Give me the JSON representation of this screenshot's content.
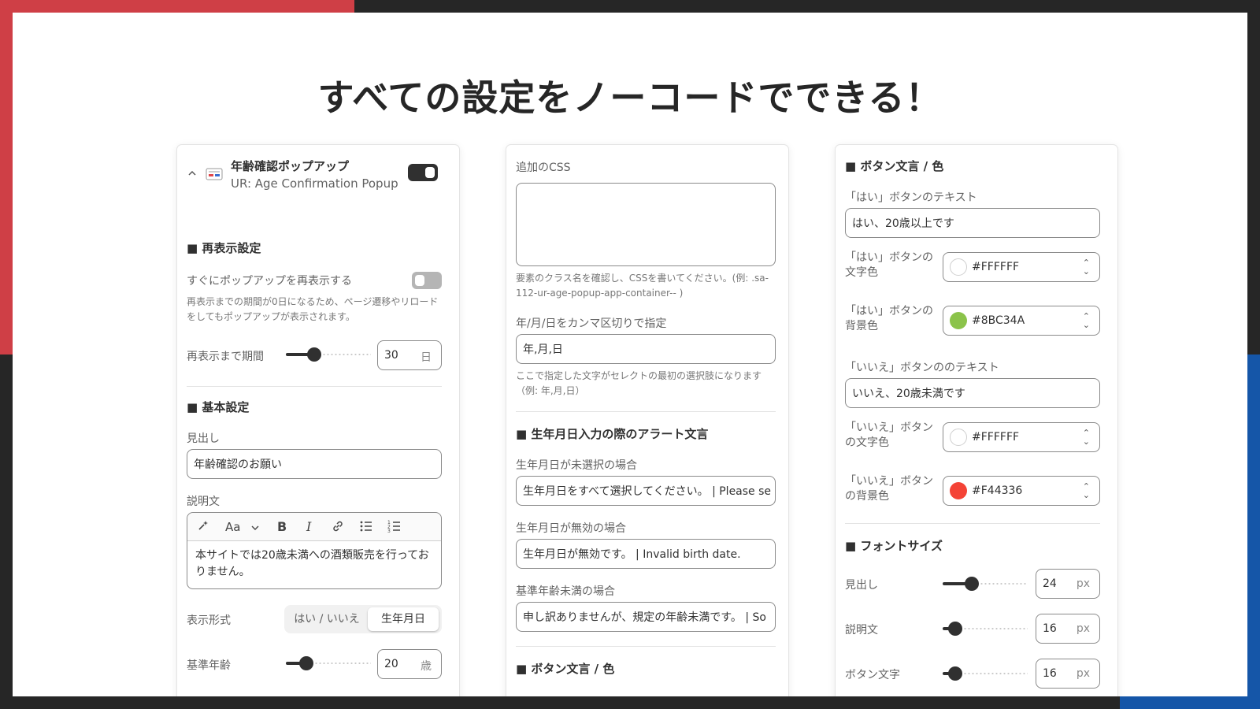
{
  "headline": "すべての設定をノーコードでできる！",
  "panel1": {
    "app_title": "年齢確認ポップアップ",
    "app_subtitle": "UR: Age Confirmation Popup",
    "redisplay": {
      "title": "■ 再表示設定",
      "toggle_label": "すぐにポップアップを再表示する",
      "help": "再表示までの期間が0日になるため、ページ遷移やリロードをしてもポップアップが表示されます。",
      "period_label": "再表示まで期間",
      "period_value": "30",
      "period_unit": "日",
      "period_fraction": 0.33
    },
    "basic": {
      "title": "■ 基本設定",
      "heading_label": "見出し",
      "heading_value": "年齢確認のお願い",
      "desc_label": "説明文",
      "desc_value": "本サイトでは20歳未満への酒類販売を行っておりません。",
      "format_label": "表示形式",
      "format_options": [
        "はい / いいえ",
        "生年月日"
      ],
      "format_selected": "生年月日",
      "age_label": "基準年齢",
      "age_value": "20",
      "age_unit": "歳",
      "age_fraction": 0.24
    }
  },
  "panel2": {
    "css_label": "追加のCSS",
    "css_value": "",
    "css_help": "要素のクラス名を確認し、CSSを書いてください。(例: .sa-112-ur-age-popup-app-container-- )",
    "date_order_label": "年/月/日をカンマ区切りで指定",
    "date_order_value": "年,月,日",
    "date_order_help": "ここで指定した文字がセレクトの最初の選択肢になります（例: 年,月,日）",
    "alerts_title": "■ 生年月日入力の際のアラート文言",
    "unselected_label": "生年月日が未選択の場合",
    "unselected_value": "生年月日をすべて選択してください。 | Please se",
    "invalid_label": "生年月日が無効の場合",
    "invalid_value": "生年月日が無効です。 | Invalid birth date.",
    "underage_label": "基準年齢未満の場合",
    "underage_value": "申し訳ありませんが、規定の年齢未満です。 | So",
    "buttons_title": "■ ボタン文言 / 色"
  },
  "panel3": {
    "buttons_title": "■ ボタン文言 / 色",
    "yes_text_label": "「はい」ボタンのテキスト",
    "yes_text_value": "はい、20歳以上です",
    "yes_fg_label": "「はい」ボタンの文字色",
    "yes_fg_value": "#FFFFFF",
    "yes_bg_label": "「はい」ボタンの背景色",
    "yes_bg_value": "#8BC34A",
    "no_text_label": "「いいえ」ボタンののテキスト",
    "no_text_value": "いいえ、20歳未満です",
    "no_fg_label": "「いいえ」ボタンの文字色",
    "no_fg_value": "#FFFFFF",
    "no_bg_label": "「いいえ」ボタンの背景色",
    "no_bg_value": "#F44336",
    "font_title": "■ フォントサイズ",
    "heading_size_label": "見出し",
    "heading_size_value": "24",
    "heading_size_fraction": 0.34,
    "desc_size_label": "説明文",
    "desc_size_value": "16",
    "desc_size_fraction": 0.15,
    "btn_size_label": "ボタン文字",
    "btn_size_value": "16",
    "btn_size_fraction": 0.15,
    "unit": "px"
  },
  "colors": {
    "red_accent": "#cf3f46",
    "blue_accent": "#1556a8",
    "frame_dark": "#262626"
  },
  "icons": [
    "chevron-up-icon",
    "app-icon",
    "magic-icon",
    "font-icon",
    "chevron-down-icon",
    "bold-icon",
    "italic-icon",
    "link-icon",
    "bullet-list-icon",
    "numbered-list-icon",
    "select-chevron-icon"
  ]
}
